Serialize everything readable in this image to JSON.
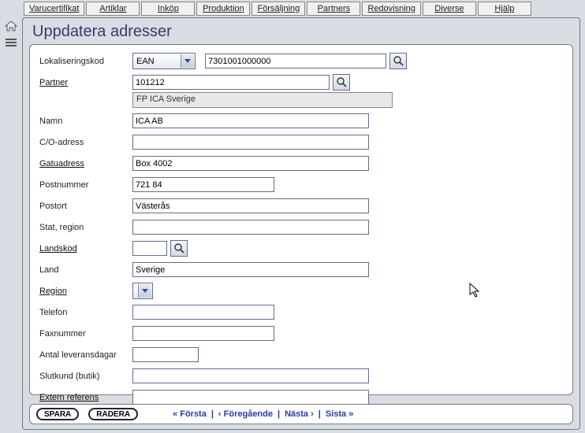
{
  "tabs": [
    "Varucertifikat",
    "Artiklar",
    "Inköp",
    "Produktion",
    "Försäljning",
    "Partners",
    "Redovisning",
    "Diverse",
    "Hjälp"
  ],
  "header": "Uppdatera adresser",
  "form": {
    "lokaliseringskod_label": "Lokaliseringskod",
    "lokaliseringskod_select": "EAN",
    "lokaliseringskod_value": "7301001000000",
    "partner_label": "Partner",
    "partner_value": "101212",
    "partner_name": "FP ICA Sverige",
    "namn_label": "Namn",
    "namn_value": "ICA AB",
    "co_label": "C/O-adress",
    "co_value": "",
    "gatu_label": "Gatuadress",
    "gatu_value": "Box 4002",
    "postnr_label": "Postnummer",
    "postnr_value": "721 84",
    "postort_label": "Postort",
    "postort_value": "Västerås",
    "stat_label": "Stat, region",
    "stat_value": "",
    "landskod_label": "Landskod",
    "landskod_value": "",
    "land_label": "Land",
    "land_value": "Sverige",
    "region_label": "Region",
    "telefon_label": "Telefon",
    "telefon_value": "",
    "fax_label": "Faxnummer",
    "fax_value": "",
    "leveransdagar_label": "Antal leveransdagar",
    "leveransdagar_value": "",
    "slutkund_label": "Slutkund (butik)",
    "slutkund_value": "",
    "extern_label": "Extern referens",
    "extern_value": ""
  },
  "footer": {
    "save": "SPARA",
    "delete": "RADERA",
    "first": "« Första",
    "prev": "‹ Föregående",
    "next": "Nästa ›",
    "last": "Sista »"
  }
}
